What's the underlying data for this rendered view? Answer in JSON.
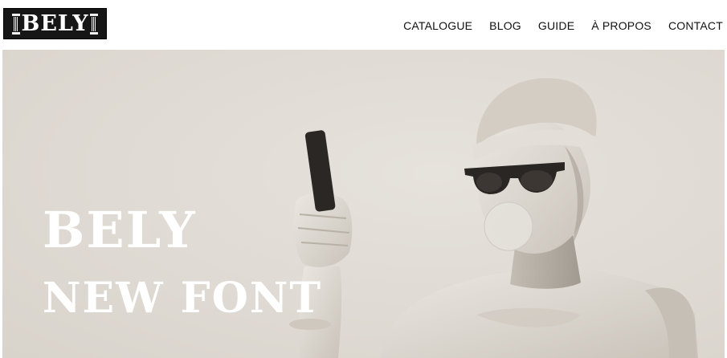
{
  "header": {
    "logo_text": "BELY",
    "nav": [
      "CATALOGUE",
      "BLOG",
      "GUIDE",
      "À PROPOS",
      "CONTACT"
    ]
  },
  "hero": {
    "title_line1": "BELY",
    "title_line2": "NEW FONT"
  },
  "colors": {
    "background": "#ffffff",
    "hero_bg": "#dfdad3",
    "logo_bg": "#161616",
    "hero_text": "#ffffff",
    "nav_text": "#111111"
  }
}
